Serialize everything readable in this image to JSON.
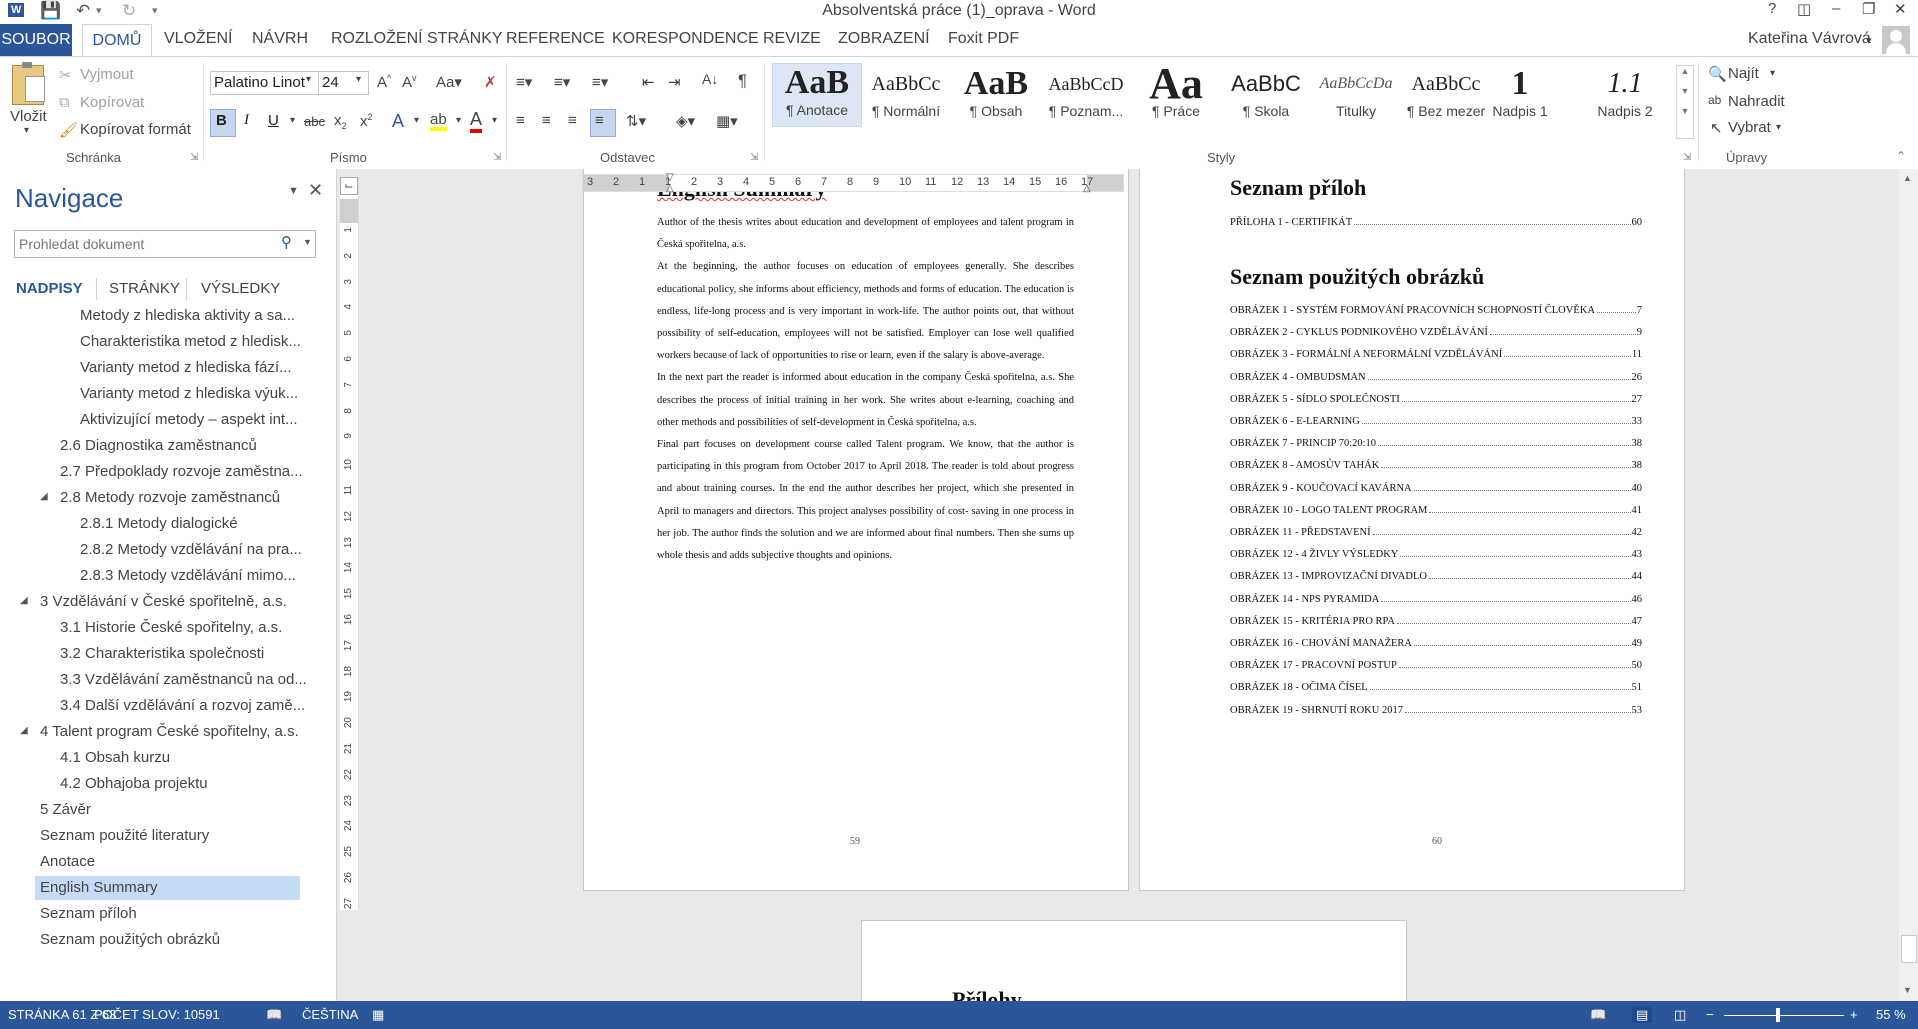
{
  "window": {
    "title": "Absolventská práce (1)_oprava - Word",
    "user": "Kateřina Vávrová",
    "help": "?",
    "minimize": "–",
    "restore": "❐",
    "close": "✕"
  },
  "tabs": {
    "file": "SOUBOR",
    "home": "DOMŮ",
    "insert": "VLOŽENÍ",
    "design": "NÁVRH",
    "layout": "ROZLOŽENÍ STRÁNKY",
    "references": "REFERENCE",
    "mailings": "KORESPONDENCE",
    "review": "REVIZE",
    "view": "ZOBRAZENÍ",
    "foxit": "Foxit PDF"
  },
  "ribbon": {
    "clipboard": {
      "paste": "Vložit",
      "cut": "Vyjmout",
      "copy": "Kopírovat",
      "format_painter": "Kopírovat formát",
      "label": "Schránka"
    },
    "font": {
      "family": "Palatino Linot",
      "size": "24",
      "label": "Písmo"
    },
    "paragraph": {
      "label": "Odstavec"
    },
    "styles": {
      "label": "Styly",
      "items": [
        {
          "preview": "AaB",
          "name": "¶ Anotace"
        },
        {
          "preview": "AaBbCc",
          "name": "¶ Normální"
        },
        {
          "preview": "AaB",
          "name": "¶ Obsah"
        },
        {
          "preview": "AaBbCcD",
          "name": "¶ Poznam..."
        },
        {
          "preview": "Aa",
          "name": "¶ Práce"
        },
        {
          "preview": "AaBbC",
          "name": "¶ Skola"
        },
        {
          "preview": "AaBbCcDa",
          "name": "Titulky"
        },
        {
          "preview": "AaBbCc",
          "name": "¶ Bez mezer"
        },
        {
          "preview": "1",
          "name": "Nadpis 1"
        },
        {
          "preview": "1.1",
          "name": "Nadpis 2"
        }
      ]
    },
    "editing": {
      "find": "Najít",
      "replace": "Nahradit",
      "select": "Vybrat",
      "label": "Úpravy"
    }
  },
  "nav": {
    "title": "Navigace",
    "search_placeholder": "Prohledat dokument",
    "tabs": [
      "NADPISY",
      "STRÁNKY",
      "VÝSLEDKY"
    ],
    "items": [
      "Metody z hlediska aktivity a sa...",
      "Charakteristika metod z hledisk...",
      "Varianty metod z hlediska fází...",
      "Varianty metod z hlediska výuk...",
      "Aktivizující metody – aspekt int...",
      "2.6 Diagnostika zaměstnanců",
      "2.7 Předpoklady rozvoje zaměstna...",
      "2.8 Metody rozvoje zaměstnanců",
      "2.8.1 Metody dialogické",
      "2.8.2 Metody vzdělávání na pra...",
      "2.8.3 Metody vzdělávání mimo...",
      "3 Vzdělávání v České spořitelně, a.s.",
      "3.1 Historie České spořitelny, a.s.",
      "3.2 Charakteristika společnosti",
      "3.3 Vzdělávání zaměstnanců na od...",
      "3.4 Další vzdělávání a rozvoj zamě...",
      "4 Talent program České spořitelny, a.s.",
      "4.1 Obsah kurzu",
      "4.2 Obhajoba projektu",
      "5 Závěr",
      "Seznam použité literatury",
      "Anotace",
      "English Summary",
      "Seznam příloh",
      "Seznam použitých obrázků"
    ]
  },
  "page59": {
    "heading": "English Summary",
    "paragraphs": [
      "Author of the thesis writes about education and development of employees and talent program in Česká spořitelna, a.s.",
      "At the beginning, the author focuses on education of employees generally. She describes educational policy, she informs about efficiency, methods and forms of education. The education is endless, life-long process and is very important in work-life. The author points out, that without possibility of self-education, employees will not be satisfied. Employer can lose well qualified workers because of lack of opportunities to rise or learn, even if the salary is above-average.",
      "In the next part the reader is informed about education in the company Česká spořitelna, a.s. She describes the process of initial training in her work. She writes about e-learning, coaching and other methods and possibilities of self-development in Česká spořitelna, a.s.",
      "Final part focuses on development course called Talent program. We know, that the author is participating in this program from October 2017 to April 2018. The reader is told about progress and about training courses. In the end the author describes her project, which she presented in April to managers and directors. This project analyses possibility of cost- saving in one process in her job. The author finds the solution and we are informed about final numbers. Then she sums up whole thesis and adds subjective thoughts and opinions."
    ],
    "page_number": "59"
  },
  "page60": {
    "heading1": "Seznam příloh",
    "attachments": [
      {
        "text": "PŘÍLOHA 1 - CERTIFIKÁT",
        "page": "60"
      }
    ],
    "heading2": "Seznam použitých obrázků",
    "figures": [
      {
        "text": "OBRÁZEK 1 - SYSTÉM FORMOVÁNÍ PRACOVNÍCH SCHOPNOSTÍ ČLOVĚKA",
        "page": "7"
      },
      {
        "text": "OBRÁZEK 2 - CYKLUS PODNIKOVÉHO VZDĚLÁVÁNÍ",
        "page": "9"
      },
      {
        "text": "OBRÁZEK 3 - FORMÁLNÍ A NEFORMÁLNÍ VZDĚLÁVÁNÍ",
        "page": "11"
      },
      {
        "text": "OBRÁZEK 4 - OMBUDSMAN",
        "page": "26"
      },
      {
        "text": "OBRÁZEK 5 - SÍDLO SPOLEČNOSTI",
        "page": "27"
      },
      {
        "text": "OBRÁZEK 6 - E-LEARNING",
        "page": "33"
      },
      {
        "text": "OBRÁZEK 7 - PRINCIP 70:20:10",
        "page": "38"
      },
      {
        "text": "OBRÁZEK 8 - AMOSŮV TAHÁK",
        "page": "38"
      },
      {
        "text": "OBRÁZEK 9 - KOUČOVACÍ KAVÁRNA",
        "page": "40"
      },
      {
        "text": "OBRÁZEK 10 - LOGO TALENT PROGRAM",
        "page": "41"
      },
      {
        "text": "OBRÁZEK 11 - PŘEDSTAVENÍ",
        "page": "42"
      },
      {
        "text": "OBRÁZEK 12 - 4 ŽIVLY VÝSLEDKY",
        "page": "43"
      },
      {
        "text": "OBRÁZEK 13 - IMPROVIZAČNÍ DIVADLO",
        "page": "44"
      },
      {
        "text": "OBRÁZEK 14 - NPS PYRAMIDA",
        "page": "46"
      },
      {
        "text": "OBRÁZEK 15 - KRITÉRIA PRO RPA",
        "page": "47"
      },
      {
        "text": "OBRÁZEK 16 - CHOVÁNÍ MANAŽERA",
        "page": "49"
      },
      {
        "text": "OBRÁZEK 17 - PRACOVNÍ POSTUP",
        "page": "50"
      },
      {
        "text": "OBRÁZEK 18 - OČIMA ČÍSEL",
        "page": "51"
      },
      {
        "text": "OBRÁZEK 19 - SHRNUTÍ ROKU 2017",
        "page": "53"
      }
    ],
    "page_number": "60"
  },
  "page61": {
    "heading": "Přílohy"
  },
  "ruler": {
    "numbers": [
      "3",
      "2",
      "1",
      "1",
      "2",
      "3",
      "4",
      "5",
      "6",
      "7",
      "8",
      "9",
      "10",
      "11",
      "12",
      "13",
      "14",
      "15",
      "16",
      "17"
    ],
    "vnumbers": [
      "1",
      "2",
      "3",
      "4",
      "5",
      "6",
      "7",
      "8",
      "9",
      "10",
      "11",
      "12",
      "13",
      "14",
      "15",
      "16",
      "17",
      "18",
      "19",
      "20",
      "21",
      "22",
      "23",
      "24",
      "25",
      "26",
      "27"
    ]
  },
  "status": {
    "page": "STRÁNKA 61 Z 63",
    "words": "POČET SLOV: 10591",
    "language": "ČEŠTINA",
    "zoom": "55 %"
  }
}
